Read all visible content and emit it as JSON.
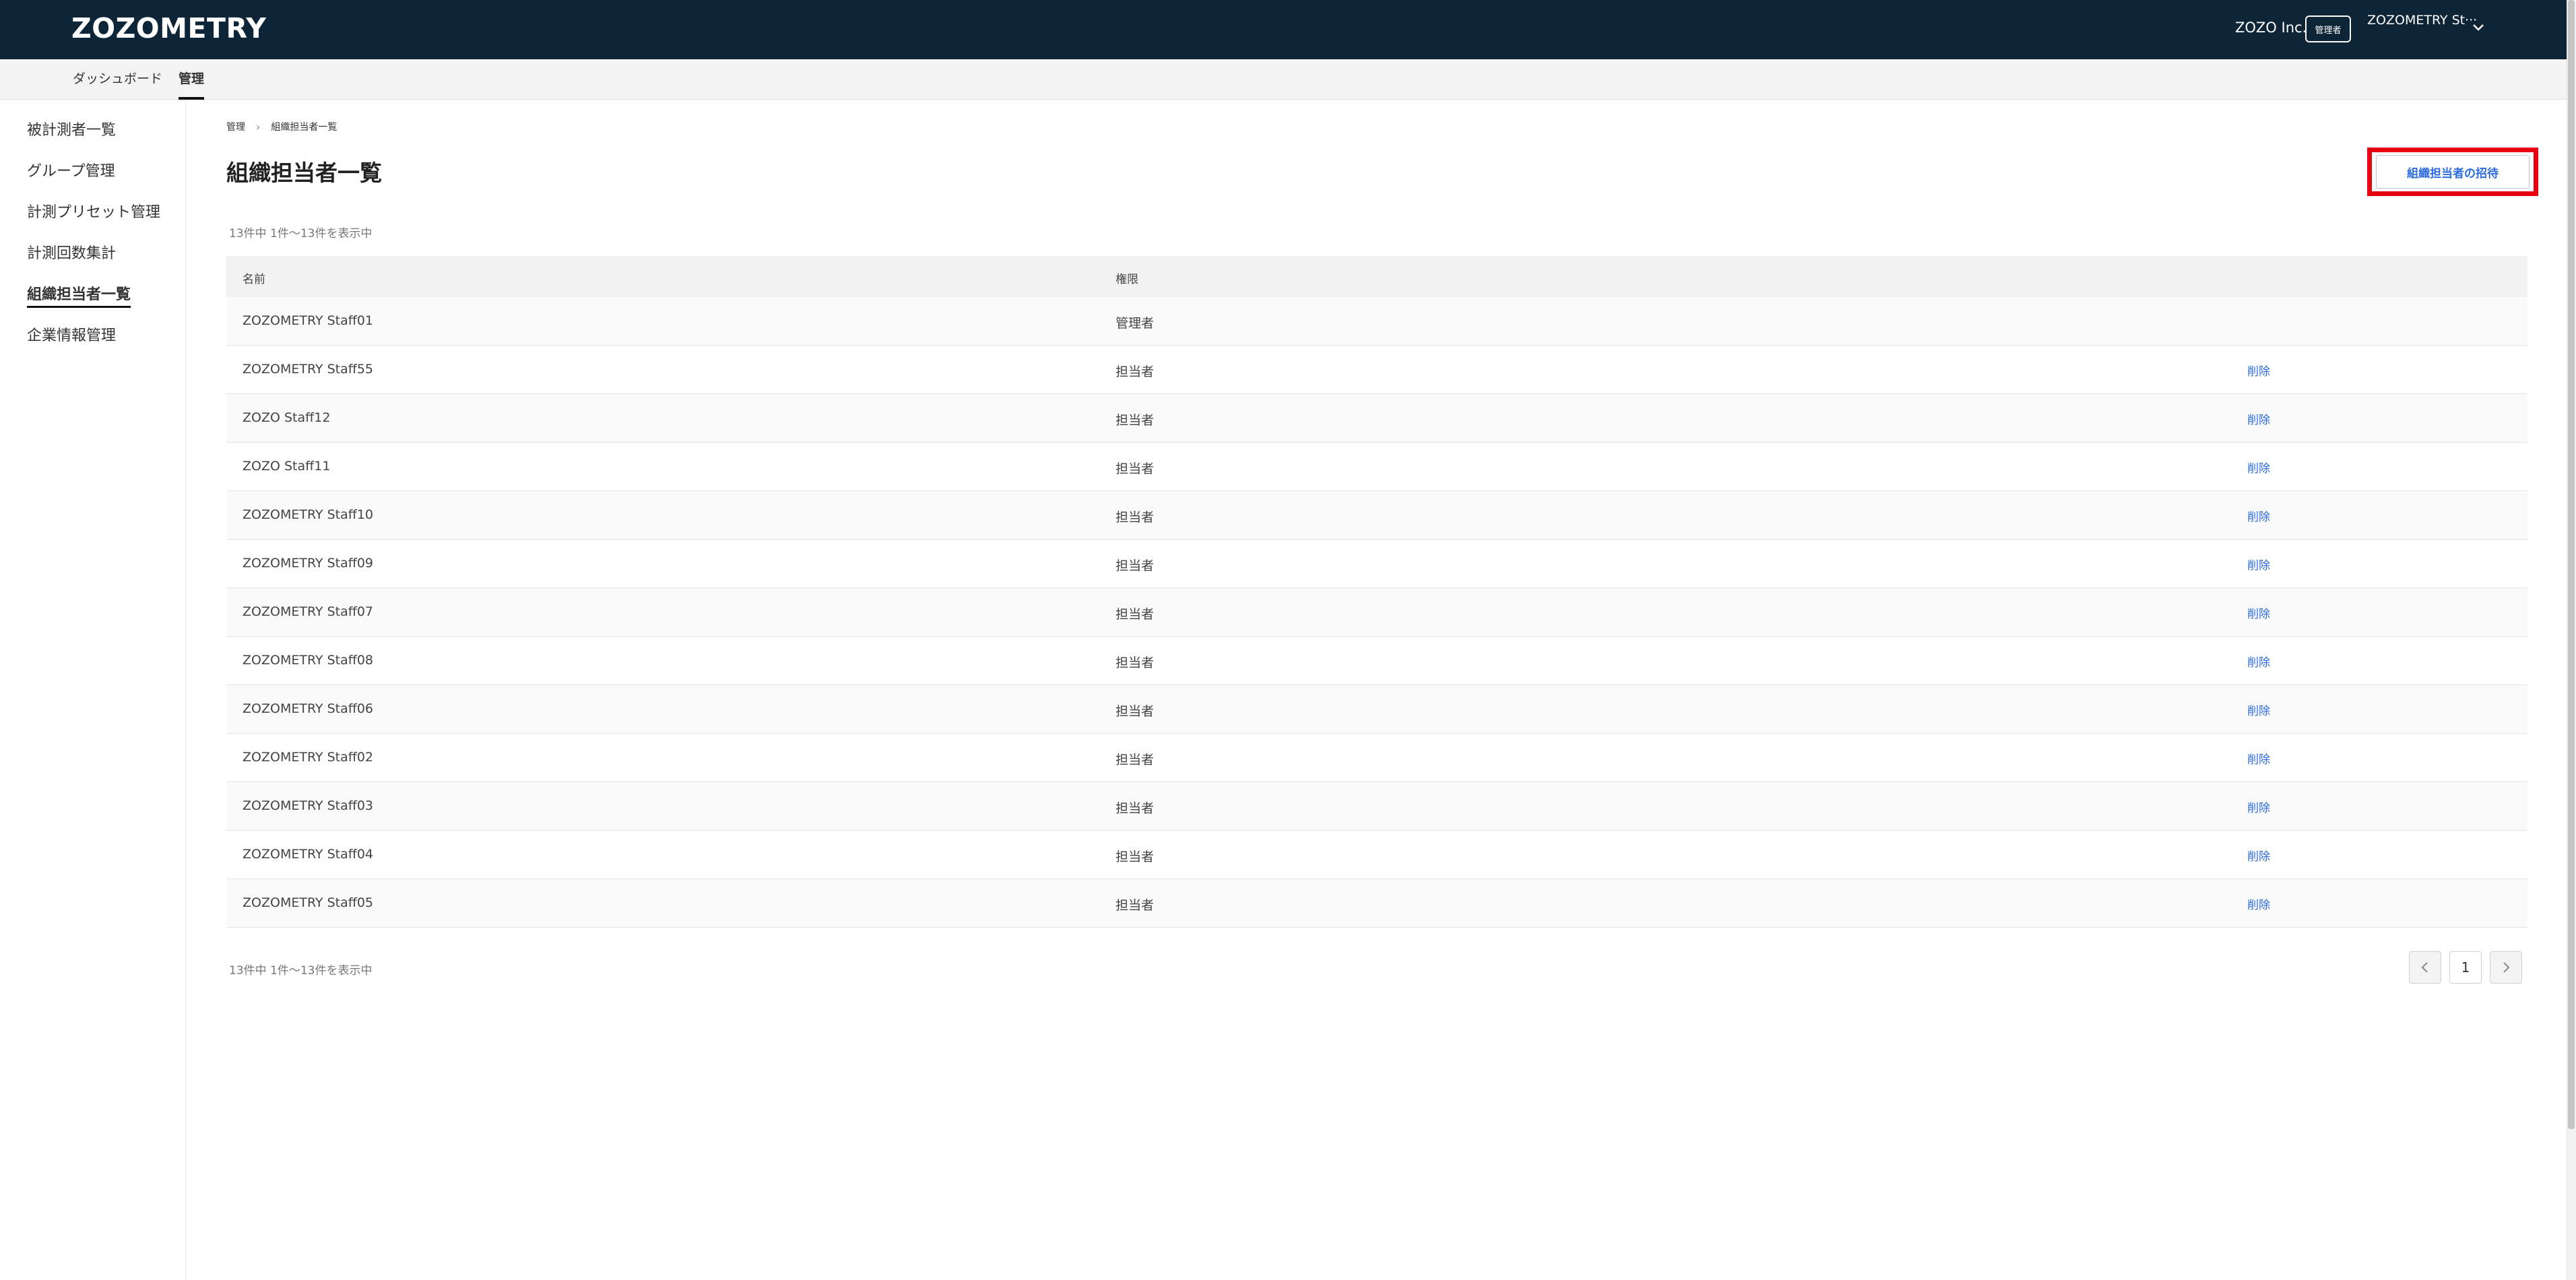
{
  "header": {
    "logo": "ZOZOMETRY",
    "org_name": "ZOZO Inc.",
    "role_badge": "管理者",
    "user_name": "ZOZOMETRY St···",
    "colors": {
      "header_bg": "#0d2537"
    }
  },
  "subnav": {
    "items": [
      {
        "label": "ダッシュボード"
      },
      {
        "label": "管理"
      }
    ]
  },
  "sidebar": {
    "items": [
      {
        "label": "被計測者一覧"
      },
      {
        "label": "グループ管理"
      },
      {
        "label": "計測プリセット管理"
      },
      {
        "label": "計測回数集計"
      },
      {
        "label": "組織担当者一覧"
      },
      {
        "label": "企業情報管理"
      }
    ]
  },
  "breadcrumb": {
    "items": [
      "管理",
      "組織担当者一覧"
    ]
  },
  "page": {
    "title": "組織担当者一覧",
    "invite_button": "組織担当者の招待",
    "count_top": "13件中 1件〜13件を表示中",
    "count_bottom": "13件中 1件〜13件を表示中"
  },
  "table": {
    "headers": [
      "名前",
      "権限"
    ],
    "rows": [
      {
        "name": "ZOZOMETRY Staff01",
        "role": "管理者",
        "action": ""
      },
      {
        "name": "ZOZOMETRY Staff55",
        "role": "担当者",
        "action": "削除"
      },
      {
        "name": "ZOZO Staff12",
        "role": "担当者",
        "action": "削除"
      },
      {
        "name": "ZOZO Staff11",
        "role": "担当者",
        "action": "削除"
      },
      {
        "name": "ZOZOMETRY Staff10",
        "role": "担当者",
        "action": "削除"
      },
      {
        "name": "ZOZOMETRY Staff09",
        "role": "担当者",
        "action": "削除"
      },
      {
        "name": "ZOZOMETRY Staff07",
        "role": "担当者",
        "action": "削除"
      },
      {
        "name": "ZOZOMETRY Staff08",
        "role": "担当者",
        "action": "削除"
      },
      {
        "name": "ZOZOMETRY Staff06",
        "role": "担当者",
        "action": "削除"
      },
      {
        "name": "ZOZOMETRY Staff02",
        "role": "担当者",
        "action": "削除"
      },
      {
        "name": "ZOZOMETRY Staff03",
        "role": "担当者",
        "action": "削除"
      },
      {
        "name": "ZOZOMETRY Staff04",
        "role": "担当者",
        "action": "削除"
      },
      {
        "name": "ZOZOMETRY Staff05",
        "role": "担当者",
        "action": "削除"
      }
    ]
  },
  "pagination": {
    "current_page": "1",
    "prev_icon": "chevron-left-icon",
    "next_icon": "chevron-right-icon"
  }
}
